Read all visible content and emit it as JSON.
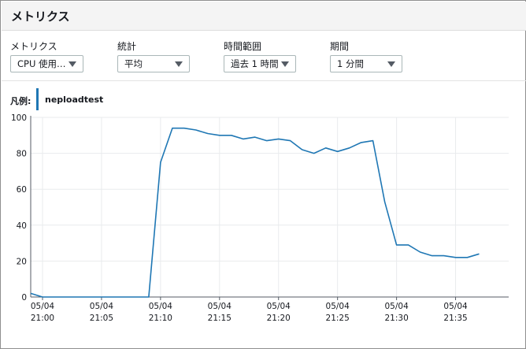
{
  "header": {
    "title": "メトリクス"
  },
  "controls": [
    {
      "label": "メトリクス",
      "value": "CPU 使用…"
    },
    {
      "label": "統計",
      "value": "平均"
    },
    {
      "label": "時間範囲",
      "value": "過去 1 時間"
    },
    {
      "label": "期間",
      "value": "1 分間"
    }
  ],
  "legend": {
    "label": "凡例:",
    "series_name": "neploadtest"
  },
  "colors": {
    "series": "#1f77b4",
    "grid": "#e9ebed",
    "axis": "#545b64"
  },
  "icons": {
    "dropdown": "triangle-down-icon"
  },
  "chart_data": {
    "type": "line",
    "ylim": [
      0,
      100
    ],
    "yticks": [
      0,
      20,
      40,
      60,
      80,
      100
    ],
    "xticks": [
      {
        "minute": 0,
        "date": "05/04",
        "time": "21:00"
      },
      {
        "minute": 5,
        "date": "05/04",
        "time": "21:05"
      },
      {
        "minute": 10,
        "date": "05/04",
        "time": "21:10"
      },
      {
        "minute": 15,
        "date": "05/04",
        "time": "21:15"
      },
      {
        "minute": 20,
        "date": "05/04",
        "time": "21:20"
      },
      {
        "minute": 25,
        "date": "05/04",
        "time": "21:25"
      },
      {
        "minute": 30,
        "date": "05/04",
        "time": "21:30"
      },
      {
        "minute": 35,
        "date": "05/04",
        "time": "21:35"
      }
    ],
    "grid": true,
    "series": [
      {
        "name": "neploadtest",
        "x": [
          -1,
          0,
          1,
          2,
          3,
          4,
          5,
          6,
          7,
          8,
          9,
          10,
          11,
          12,
          13,
          14,
          15,
          16,
          17,
          18,
          19,
          20,
          21,
          22,
          23,
          24,
          25,
          26,
          27,
          28,
          29,
          30,
          31,
          32,
          33,
          34,
          35,
          36,
          37
        ],
        "values": [
          2,
          0,
          0,
          0,
          0,
          0,
          0,
          0,
          0,
          0,
          0,
          75,
          94,
          94,
          93,
          91,
          90,
          90,
          88,
          89,
          87,
          88,
          87,
          82,
          80,
          83,
          81,
          83,
          86,
          87,
          53,
          29,
          29,
          25,
          23,
          23,
          22,
          22,
          24
        ]
      }
    ]
  }
}
